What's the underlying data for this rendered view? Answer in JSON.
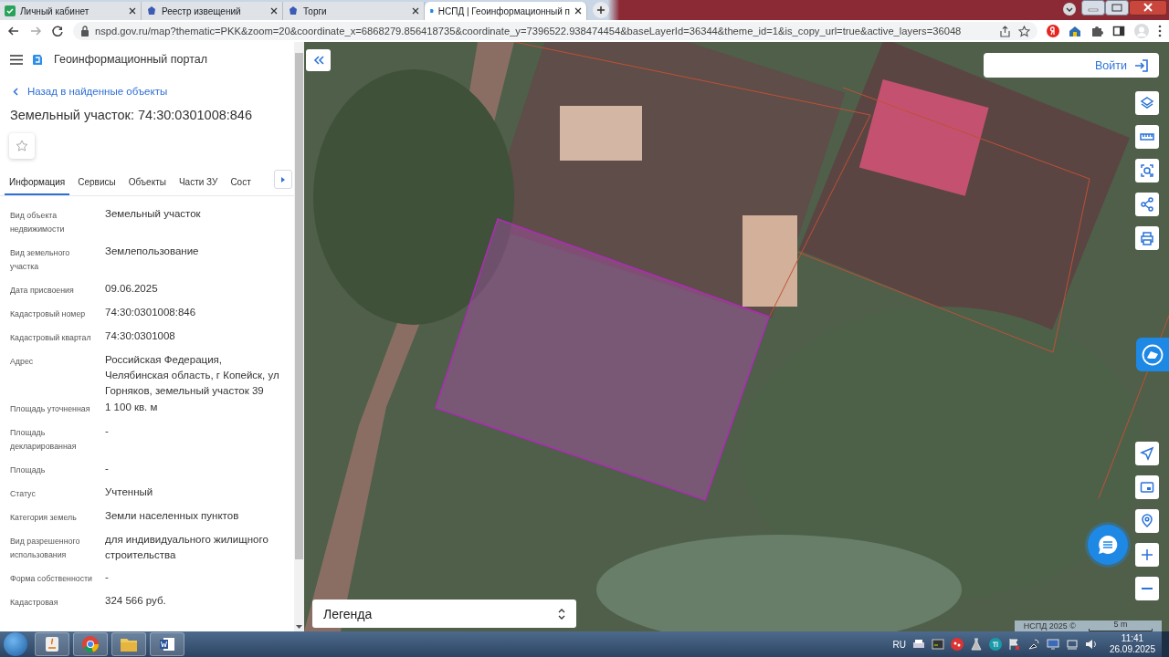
{
  "browser": {
    "tabs": [
      {
        "title": "Личный кабинет",
        "selected": false
      },
      {
        "title": "Реестр извещений",
        "selected": false
      },
      {
        "title": "Торги",
        "selected": false
      },
      {
        "title": "НСПД | Геоинформационный п",
        "selected": true
      }
    ],
    "url": "nspd.gov.ru/map?thematic=PKK&zoom=20&coordinate_x=6868279.856418735&coordinate_y=7396522.938474454&baseLayerId=36344&theme_id=1&is_copy_url=true&active_layers=36048"
  },
  "panel": {
    "portal_title": "Геоинформационный портал",
    "back_link": "Назад в найденные объекты",
    "object_title": "Земельный участок: 74:30:0301008:846",
    "favorite": false,
    "tabs": [
      {
        "label": "Информация",
        "selected": true
      },
      {
        "label": "Сервисы",
        "selected": false
      },
      {
        "label": "Объекты",
        "selected": false
      },
      {
        "label": "Части ЗУ",
        "selected": false
      },
      {
        "label": "Сост",
        "selected": false
      }
    ],
    "properties": [
      {
        "label": "Вид объекта недвижимости",
        "value": "Земельный участок"
      },
      {
        "label": "Вид земельного участка",
        "value": "Землепользование"
      },
      {
        "label": "Дата присвоения",
        "value": "09.06.2025"
      },
      {
        "label": "Кадастровый номер",
        "value": "74:30:0301008:846"
      },
      {
        "label": "Кадастровый квартал",
        "value": "74:30:0301008"
      },
      {
        "label": "Адрес",
        "value": "Российская Федерация, Челябинская область, г Копейск, ул Горняков, земельный участок 39"
      },
      {
        "label": "Площадь уточненная",
        "value": "1 100 кв. м"
      },
      {
        "label": "Площадь декларированная",
        "value": "-"
      },
      {
        "label": "Площадь",
        "value": "-"
      },
      {
        "label": "Статус",
        "value": "Учтенный"
      },
      {
        "label": "Категория земель",
        "value": "Земли населенных пунктов"
      },
      {
        "label": "Вид разрешенного использования",
        "value": "для индивидуального жилищного строительства"
      },
      {
        "label": "Форма собственности",
        "value": "-"
      },
      {
        "label": "Кадастровая",
        "value": "324 566 руб."
      }
    ]
  },
  "map": {
    "login_button": "Войти",
    "legend": "Легенда",
    "attribution": "НСПД 2025 ©",
    "scale": "5 m"
  },
  "taskbar": {
    "language": "RU",
    "time": "11:41",
    "date": "26.09.2025"
  }
}
